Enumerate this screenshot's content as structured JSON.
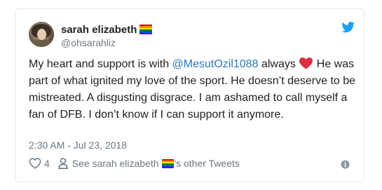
{
  "author": {
    "display_name": "sarah elizabeth",
    "handle": "@ohsarahliz",
    "name_emoji": "rainbow-flag",
    "avatar": "user-avatar-photo"
  },
  "tweet": {
    "text_before_mention": "My heart and support is with ",
    "mention": "@MesutOzil1088",
    "text_after_mention": " always ",
    "emoji": "red-heart",
    "text_end": " He was part of what ignited my love of the sport. He doesn’t deserve to be mistreated. A disgusting disgrace. I am ashamed to call myself a fan of DFB. I don’t know if I can support it anymore.",
    "timestamp": "2:30 AM - Jul 23, 2018"
  },
  "actions": {
    "like_count": "4",
    "other_tweets_prefix": "See sarah elizabeth ",
    "other_tweets_suffix": "'s other Tweets"
  },
  "icons": {
    "brand": "twitter-bird-icon",
    "like": "heart-outline-icon",
    "profile": "person-icon",
    "info": "info-icon"
  },
  "colors": {
    "link": "#2b7bb9",
    "twitter_blue": "#1da1f2",
    "muted_text": "#697882",
    "body_text": "#1c2022",
    "heart_red": "#e0245e",
    "border": "#e1e8ed"
  }
}
